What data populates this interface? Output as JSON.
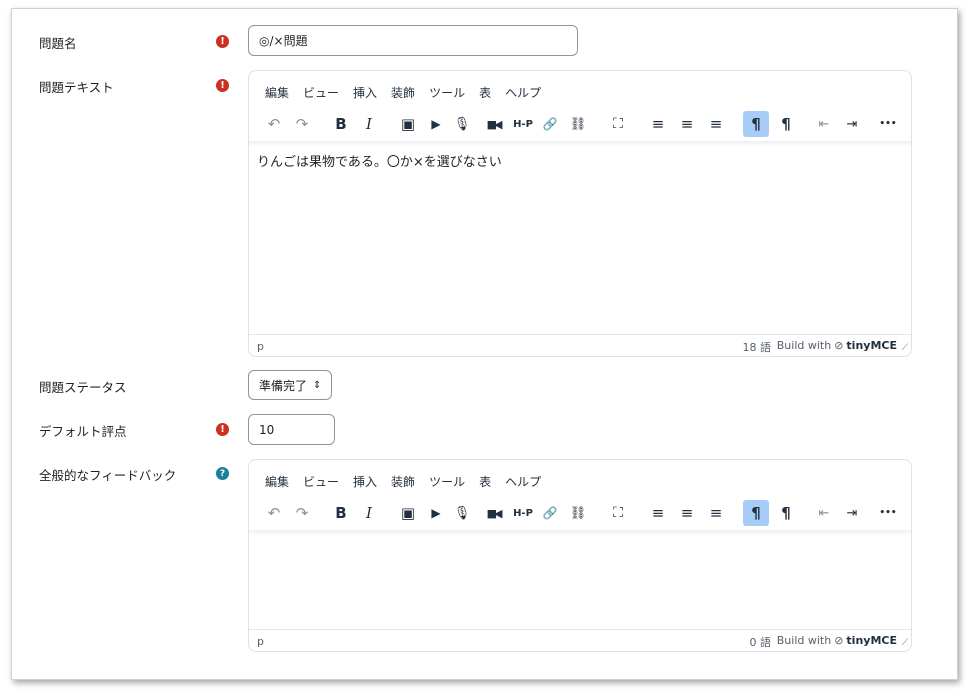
{
  "fields": {
    "name": {
      "label": "問題名",
      "value": "◎/×問題"
    },
    "text": {
      "label": "問題テキスト",
      "content": "りんごは果物である。〇か×を選びなさい",
      "path": "p",
      "wordcount": "18 語"
    },
    "status": {
      "label": "問題ステータス",
      "value": "準備完了",
      "arrow": "⇕"
    },
    "grade": {
      "label": "デフォルト評点",
      "value": "10"
    },
    "feedback": {
      "label": "全般的なフィードバック",
      "content": "",
      "path": "p",
      "wordcount": "0 語"
    }
  },
  "required_mark": "!",
  "help_mark": "?",
  "editor": {
    "menus": [
      "編集",
      "ビュー",
      "挿入",
      "装飾",
      "ツール",
      "表",
      "ヘルプ"
    ],
    "build_with": "Build with",
    "brand": "tinyMCE",
    "toolbar": [
      {
        "name": "undo-icon",
        "glyph": "↶"
      },
      {
        "name": "redo-icon",
        "glyph": "↷"
      },
      {
        "name": "bold-icon",
        "glyph": "B"
      },
      {
        "name": "italic-icon",
        "glyph": "I"
      },
      {
        "name": "image-icon",
        "glyph": "▣"
      },
      {
        "name": "media-icon",
        "glyph": "▶"
      },
      {
        "name": "microphone-icon",
        "glyph": "🎙"
      },
      {
        "name": "video-icon",
        "glyph": "■◀"
      },
      {
        "name": "h5p-icon",
        "glyph": "H-P"
      },
      {
        "name": "link-icon",
        "glyph": "🔗"
      },
      {
        "name": "unlink-icon",
        "glyph": "⛓"
      },
      {
        "name": "fullscreen-icon",
        "glyph": "⛶"
      },
      {
        "name": "align-left-icon",
        "glyph": "≡"
      },
      {
        "name": "align-center-icon",
        "glyph": "≡"
      },
      {
        "name": "align-right-icon",
        "glyph": "≡"
      },
      {
        "name": "ltr-icon",
        "glyph": "¶"
      },
      {
        "name": "rtl-icon",
        "glyph": "¶"
      },
      {
        "name": "outdent-icon",
        "glyph": "⇤"
      },
      {
        "name": "indent-icon",
        "glyph": "⇥"
      },
      {
        "name": "more-icon",
        "glyph": "•••"
      }
    ]
  },
  "colors": {
    "required": "#ca3120",
    "help": "#1f7e9a",
    "active_button": "#a6ccf7"
  }
}
